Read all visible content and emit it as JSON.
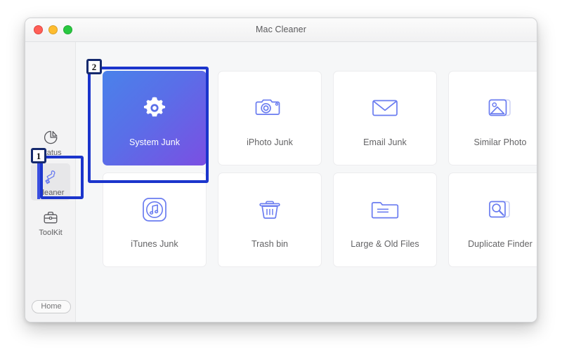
{
  "window": {
    "title": "Mac Cleaner",
    "traffic_lights": [
      {
        "name": "close",
        "color": "#ff5f57"
      },
      {
        "name": "minimize",
        "color": "#febc2e"
      },
      {
        "name": "maximize",
        "color": "#28c840"
      }
    ]
  },
  "sidebar": {
    "items": [
      {
        "label": "Status",
        "icon": "pie-chart-icon",
        "selected": false
      },
      {
        "label": "Cleaner",
        "icon": "brush-icon",
        "selected": true
      },
      {
        "label": "ToolKit",
        "icon": "briefcase-icon",
        "selected": false
      }
    ],
    "home_button": "Home"
  },
  "main": {
    "cards": [
      {
        "label": "System Junk",
        "icon": "gear-icon",
        "active": true
      },
      {
        "label": "iPhoto Junk",
        "icon": "camera-icon",
        "active": false
      },
      {
        "label": "Email Junk",
        "icon": "envelope-icon",
        "active": false
      },
      {
        "label": "Similar Photo",
        "icon": "photo-stack-icon",
        "active": false
      },
      {
        "label": "iTunes Junk",
        "icon": "music-note-icon",
        "active": false
      },
      {
        "label": "Trash bin",
        "icon": "trash-can-icon",
        "active": false
      },
      {
        "label": "Large & Old Files",
        "icon": "folder-icon",
        "active": false
      },
      {
        "label": "Duplicate Finder",
        "icon": "magnifier-stack-icon",
        "active": false
      }
    ]
  },
  "annotations": {
    "badges": [
      {
        "number": "1",
        "target": "sidebar-item-cleaner"
      },
      {
        "number": "2",
        "target": "card-system-junk"
      }
    ]
  },
  "colors": {
    "accent_blue": "#5b6ee8",
    "accent_purple": "#7b4fe2",
    "annotation_blue": "#1b35cc",
    "icon_stroke": "#6a7cf0"
  }
}
